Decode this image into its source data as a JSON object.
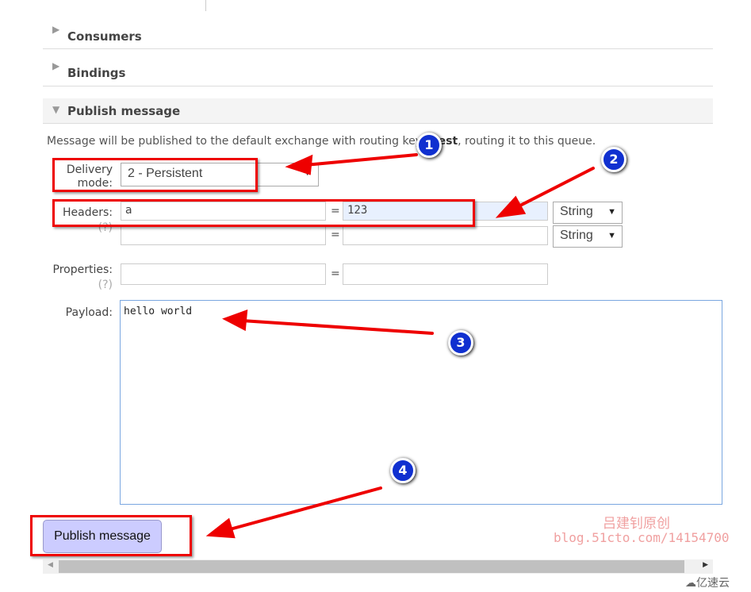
{
  "sections": [
    {
      "label": "Consumers",
      "expanded": false
    },
    {
      "label": "Bindings",
      "expanded": false
    },
    {
      "label": "Publish message",
      "expanded": true
    }
  ],
  "publish": {
    "intro_pre": "Message will be published to the default exchange with routing key ",
    "routing_key": "atest",
    "intro_post": ", routing it to this queue.",
    "delivery_label": "Delivery mode:",
    "delivery_value": "2 - Persistent",
    "headers_label": "Headers:",
    "help": "(?)",
    "headers": [
      {
        "key": "a",
        "value": "123",
        "type": "String"
      },
      {
        "key": "",
        "value": "",
        "type": "String"
      }
    ],
    "properties_label": "Properties:",
    "payload_label": "Payload:",
    "payload": "hello world",
    "equals": "=",
    "submit": "Publish message"
  },
  "annotations": [
    "1",
    "2",
    "3",
    "4"
  ],
  "watermark": {
    "line1": "吕建钊原创",
    "line2": "blog.51cto.com/14154700",
    "logo": "亿速云"
  },
  "colors": {
    "annotation_red": "#e00000",
    "annotation_blue": "#1030d0",
    "button": "#ccccff"
  }
}
